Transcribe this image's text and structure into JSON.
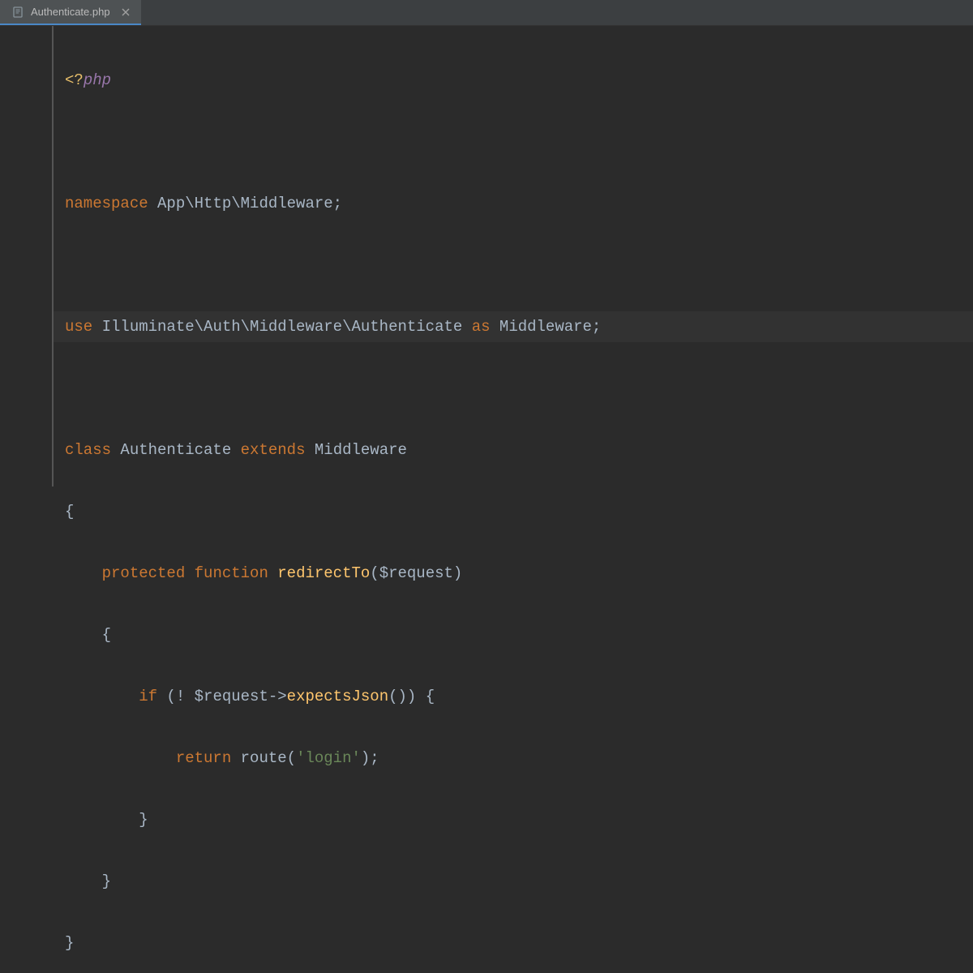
{
  "tab": {
    "filename": "Authenticate.php"
  },
  "code": {
    "l1": {
      "open_tag": "<?",
      "php": "php"
    },
    "l3": {
      "kw_namespace": "namespace",
      "ns": " App\\Http\\Middleware;"
    },
    "l5": {
      "kw_use": "use",
      "path": " Illuminate\\Auth\\Middleware\\Authenticate ",
      "kw_as": "as",
      "alias": " Middleware;"
    },
    "l7": {
      "kw_class": "class",
      "name": " Authenticate ",
      "kw_extends": "extends",
      "parent": " Middleware"
    },
    "l8": {
      "brace": "{"
    },
    "l9": {
      "kw_protected": "protected",
      "sp1": " ",
      "kw_function": "function",
      "sp2": " ",
      "fn": "redirectTo",
      "params": "($request)"
    },
    "l10": {
      "brace": "{"
    },
    "l11": {
      "kw_if": "if",
      "open": " (! $request",
      "arrow": "->",
      "method": "expectsJson",
      "close": "()) {"
    },
    "l12": {
      "kw_return": "return",
      "sp": " ",
      "fn": "route",
      "open": "(",
      "str": "'login'",
      "close": ");"
    },
    "l13": {
      "brace": "}"
    },
    "l14": {
      "brace": "}"
    },
    "l15": {
      "brace": "}"
    }
  }
}
